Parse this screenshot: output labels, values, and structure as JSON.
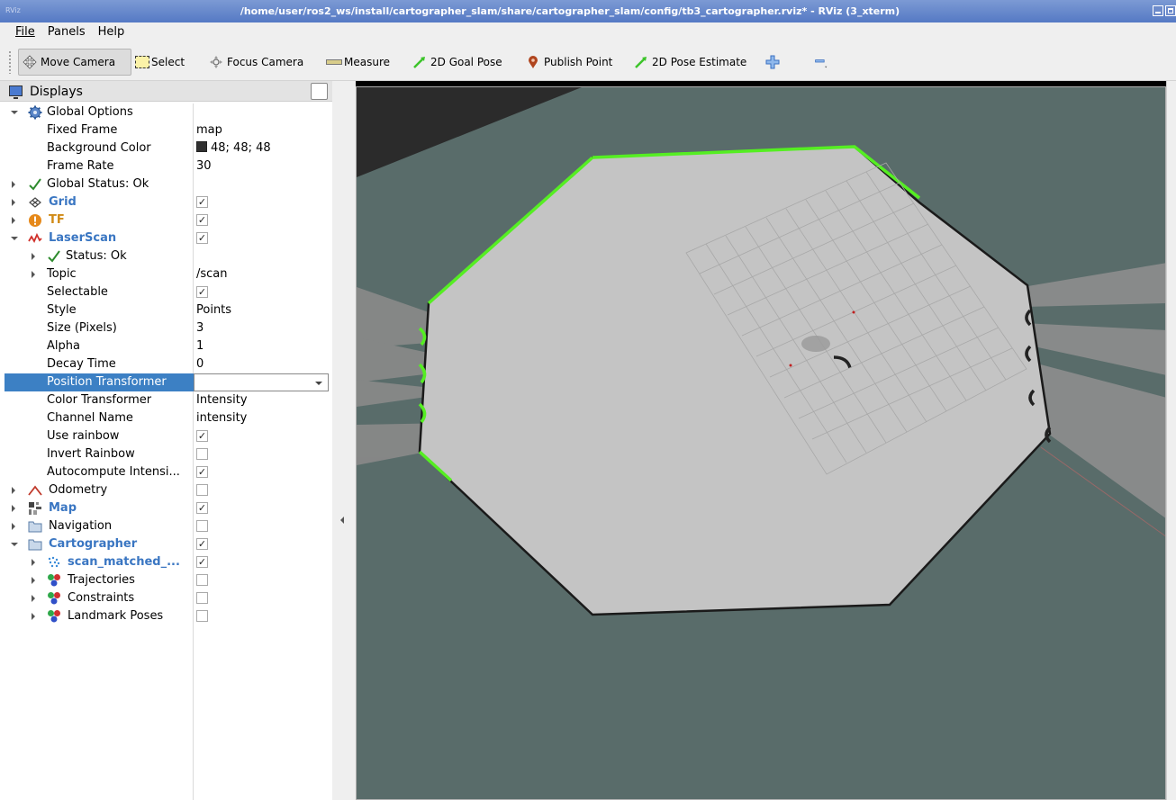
{
  "window": {
    "title": "/home/user/ros2_ws/install/cartographer_slam/share/cartographer_slam/config/tb3_cartographer.rviz* - RViz (3_xterm)",
    "app_icon_text": "RViz"
  },
  "menu": {
    "items": [
      {
        "label": "File"
      },
      {
        "label": "Panels"
      },
      {
        "label": "Help"
      }
    ]
  },
  "toolbar": {
    "move_camera": "Move Camera",
    "select": "Select",
    "focus_camera": "Focus Camera",
    "measure": "Measure",
    "goal_pose": "2D Goal Pose",
    "publish_point": "Publish Point",
    "pose_estimate": "2D Pose Estimate"
  },
  "displays": {
    "title": "Displays",
    "rows": {
      "global_options": "Global Options",
      "fixed_frame": {
        "name": "Fixed Frame",
        "value": "map"
      },
      "background_color": {
        "name": "Background Color",
        "value": "48; 48; 48",
        "color": "#303030"
      },
      "frame_rate": {
        "name": "Frame Rate",
        "value": "30"
      },
      "global_status": "Global Status: Ok",
      "grid": "Grid",
      "tf": "TF",
      "laserscan": "LaserScan",
      "status": "Status: Ok",
      "topic": {
        "name": "Topic",
        "value": "/scan"
      },
      "selectable": "Selectable",
      "style": {
        "name": "Style",
        "value": "Points"
      },
      "size": {
        "name": "Size (Pixels)",
        "value": "3"
      },
      "alpha": {
        "name": "Alpha",
        "value": "1"
      },
      "decay": {
        "name": "Decay Time",
        "value": "0"
      },
      "position_transformer": {
        "name": "Position Transformer",
        "value": ""
      },
      "color_transformer": {
        "name": "Color Transformer",
        "value": "Intensity"
      },
      "channel_name": {
        "name": "Channel Name",
        "value": "intensity"
      },
      "use_rainbow": "Use rainbow",
      "invert_rainbow": "Invert Rainbow",
      "autocompute": "Autocompute Intensi...",
      "odometry": "Odometry",
      "map": "Map",
      "navigation": "Navigation",
      "cartographer": "Cartographer",
      "scan_matched": "scan_matched_...",
      "trajectories": "Trajectories",
      "constraints": "Constraints",
      "landmark_poses": "Landmark Poses"
    },
    "checks": {
      "grid": true,
      "tf": true,
      "laserscan": true,
      "selectable": true,
      "use_rainbow": true,
      "invert_rainbow": false,
      "autocompute": true,
      "odometry": false,
      "map": true,
      "navigation": false,
      "cartographer": true,
      "scan_matched": true,
      "trajectories": false,
      "constraints": false,
      "landmark_poses": false
    }
  },
  "colors": {
    "viewport_bg": "#596c6a",
    "map_free": "#c4c4c4",
    "scan_points": "#55ee22",
    "selection": "#3c80c4"
  }
}
